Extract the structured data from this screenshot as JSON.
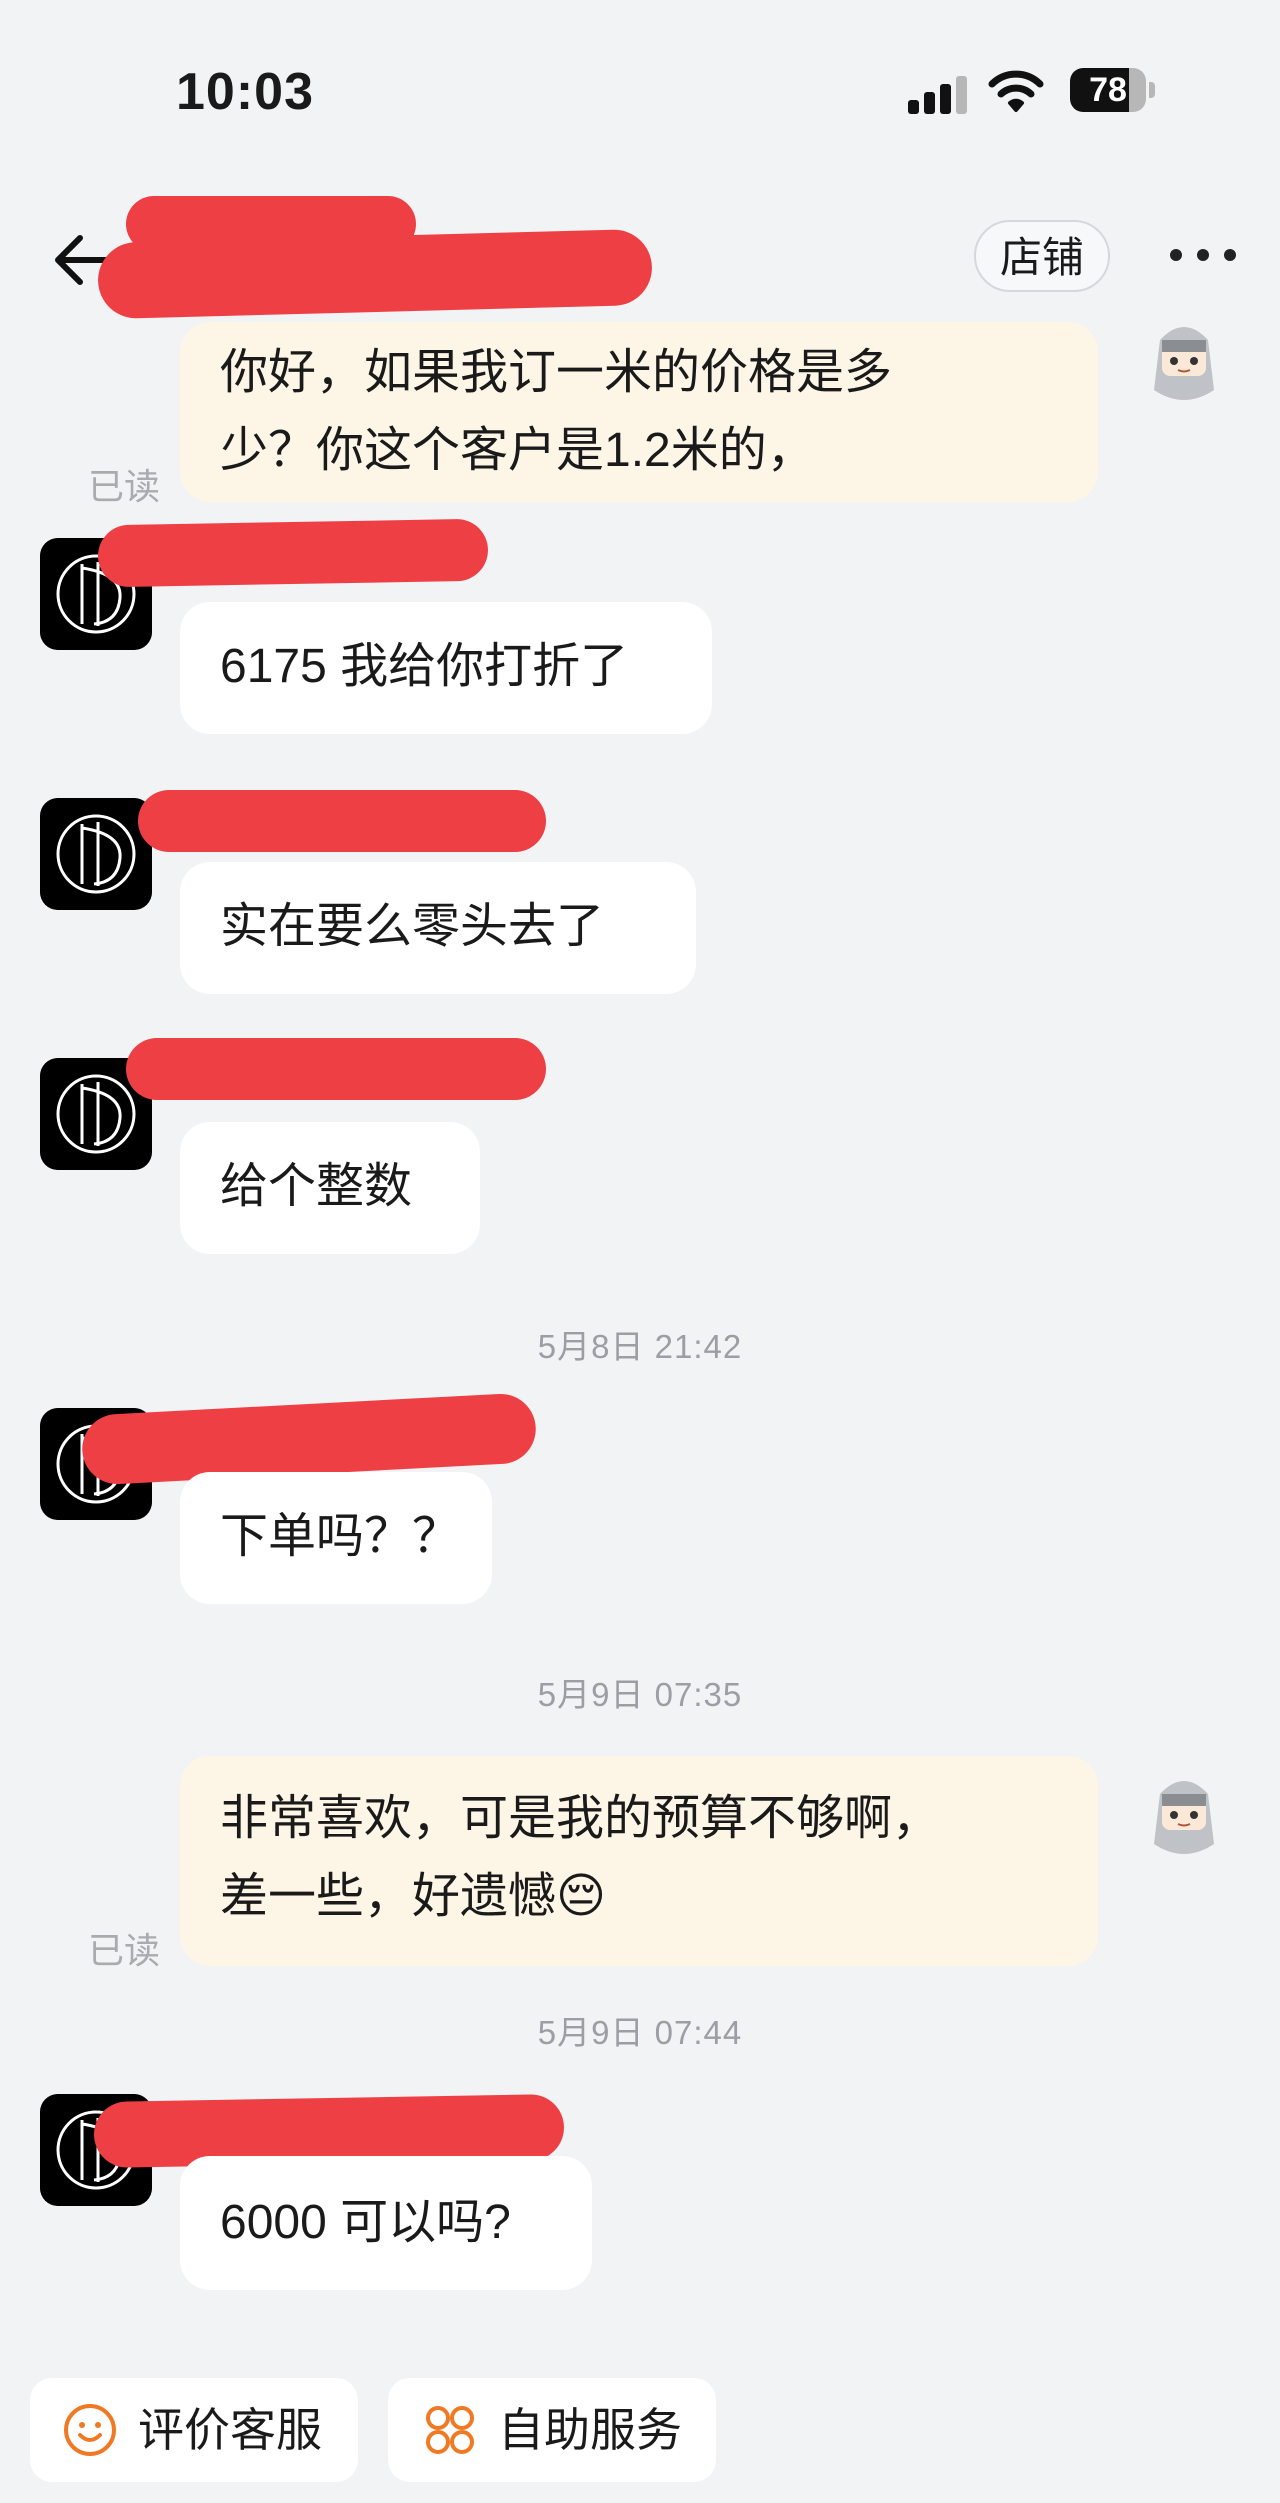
{
  "status_bar": {
    "time": "10:03",
    "battery": "78",
    "battery_level": 0.78
  },
  "nav": {
    "shop_button": "店铺"
  },
  "messages": [
    {
      "side": "me",
      "text_lines": [
        "你好，如果我订一米的价格是多",
        "少？你这个客户是1.2米的，"
      ],
      "read": "已读"
    },
    {
      "side": "shop",
      "text": "6175 我给你打折了"
    },
    {
      "side": "shop",
      "text": "实在要么零头去了"
    },
    {
      "side": "shop",
      "text": "给个整数"
    },
    {
      "timestamp": "5月8日 21:42"
    },
    {
      "side": "shop",
      "text": "下单吗？？"
    },
    {
      "timestamp": "5月9日 07:35"
    },
    {
      "side": "me",
      "text_lines": [
        "非常喜欢，可是我的预算不够啊，",
        "差一些，好遗憾😔"
      ],
      "read": "已读"
    },
    {
      "timestamp": "5月9日 07:44"
    },
    {
      "side": "shop",
      "text": "6000 可以吗?"
    }
  ],
  "quick_actions": [
    {
      "label": "评价客服",
      "icon": "smile-icon"
    },
    {
      "label": "自助服务",
      "icon": "grid-services-icon"
    }
  ],
  "colors": {
    "background": "#f2f3f5",
    "my_bubble": "#fdf6e7",
    "shop_bubble": "#ffffff",
    "redaction": "#ee3f45",
    "accent_orange": "#f07a24"
  }
}
